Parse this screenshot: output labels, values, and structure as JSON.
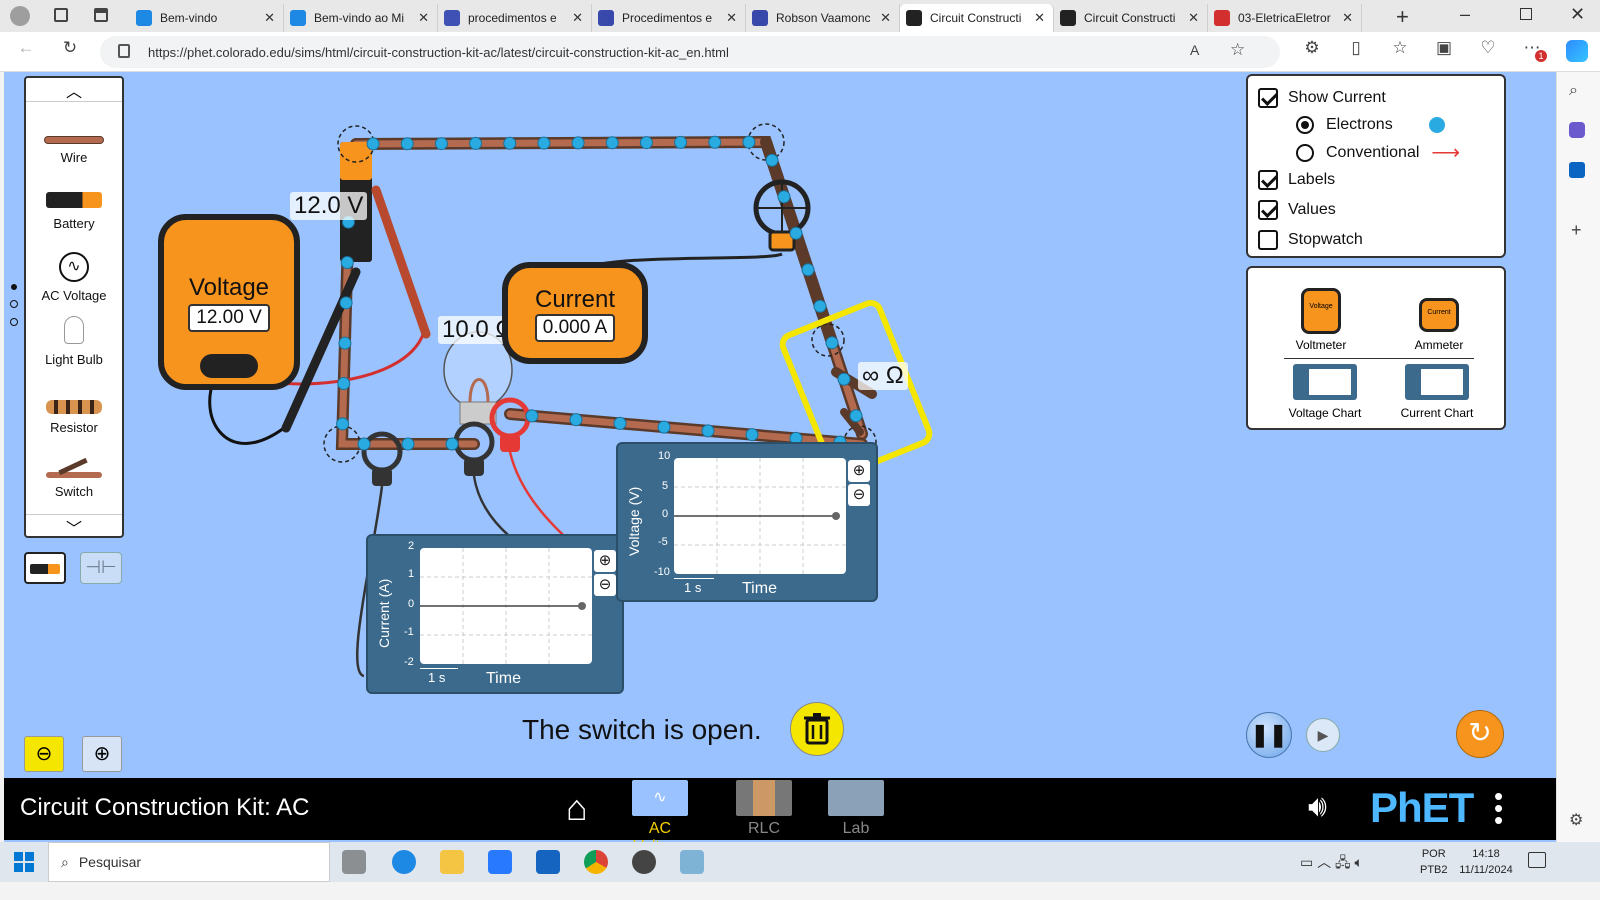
{
  "browser": {
    "tabs": [
      {
        "title": "Bem-vindo",
        "color": "#1e88e5"
      },
      {
        "title": "Bem-vindo ao Mi",
        "color": "#1e88e5"
      },
      {
        "title": "procedimentos e",
        "color": "#3f51b5"
      },
      {
        "title": "Procedimentos e",
        "color": "#3949ab"
      },
      {
        "title": "Robson Vaamonc",
        "color": "#3949ab"
      },
      {
        "title": "Circuit Constructi",
        "color": "#222222",
        "active": true
      },
      {
        "title": "Circuit Constructi",
        "color": "#222222"
      },
      {
        "title": "03-EletricaEletror",
        "color": "#d32f2f"
      }
    ],
    "url": "https://phet.colorado.edu/sims/html/circuit-construction-kit-ac/latest/circuit-construction-kit-ac_en.html",
    "notification_badge": "1"
  },
  "toolbox": {
    "items": [
      {
        "label": "Wire",
        "icon": "wire-icon"
      },
      {
        "label": "Battery",
        "icon": "battery-icon"
      },
      {
        "label": "AC Voltage",
        "icon": "ac-voltage-icon"
      },
      {
        "label": "Light Bulb",
        "icon": "light-bulb-icon"
      },
      {
        "label": "Resistor",
        "icon": "resistor-icon"
      },
      {
        "label": "Switch",
        "icon": "switch-icon"
      }
    ]
  },
  "options": {
    "show_current": "Show Current",
    "electrons": "Electrons",
    "conventional": "Conventional",
    "labels": "Labels",
    "values": "Values",
    "stopwatch": "Stopwatch"
  },
  "sensors": {
    "voltmeter": "Voltmeter",
    "ammeter": "Ammeter",
    "voltage_chart": "Voltage Chart",
    "current_chart": "Current Chart",
    "voltmeter_mini": "Voltage",
    "ammeter_mini": "Current"
  },
  "circuit": {
    "battery_value": "12.0 V",
    "bulb_value": "10.0 Ω",
    "switch_value": "∞ Ω"
  },
  "voltmeter": {
    "title": "Voltage",
    "reading": "12.00 V"
  },
  "ammeter": {
    "title": "Current",
    "reading": "0.000 A"
  },
  "voltage_chart": {
    "ylabel": "Voltage (V)",
    "xlabel": "Time",
    "scale": "1 s",
    "ticks": [
      "10",
      "5",
      "0",
      "-5",
      "-10"
    ]
  },
  "current_chart": {
    "ylabel": "Current (A)",
    "xlabel": "Time",
    "scale": "1 s",
    "ticks": [
      "2",
      "1",
      "0",
      "-1",
      "-2"
    ]
  },
  "status": "The switch is open.",
  "navbar": {
    "title": "Circuit Construction Kit: AC",
    "screens": [
      {
        "label": "AC Voltage",
        "active": true
      },
      {
        "label": "RLC",
        "active": false
      },
      {
        "label": "Lab",
        "active": false
      }
    ],
    "brand": "PhET"
  },
  "taskbar": {
    "search": "Pesquisar",
    "lang": "POR",
    "layout": "PTB2",
    "time": "14:18",
    "date": "11/11/2024"
  },
  "colors": {
    "sim_bg": "#99c2ff",
    "meter_orange": "#f7941d",
    "highlight": "#f5e600",
    "chart_panel": "#3c6a8c",
    "electron": "#29abe2",
    "active_screen": "#f5d000"
  }
}
